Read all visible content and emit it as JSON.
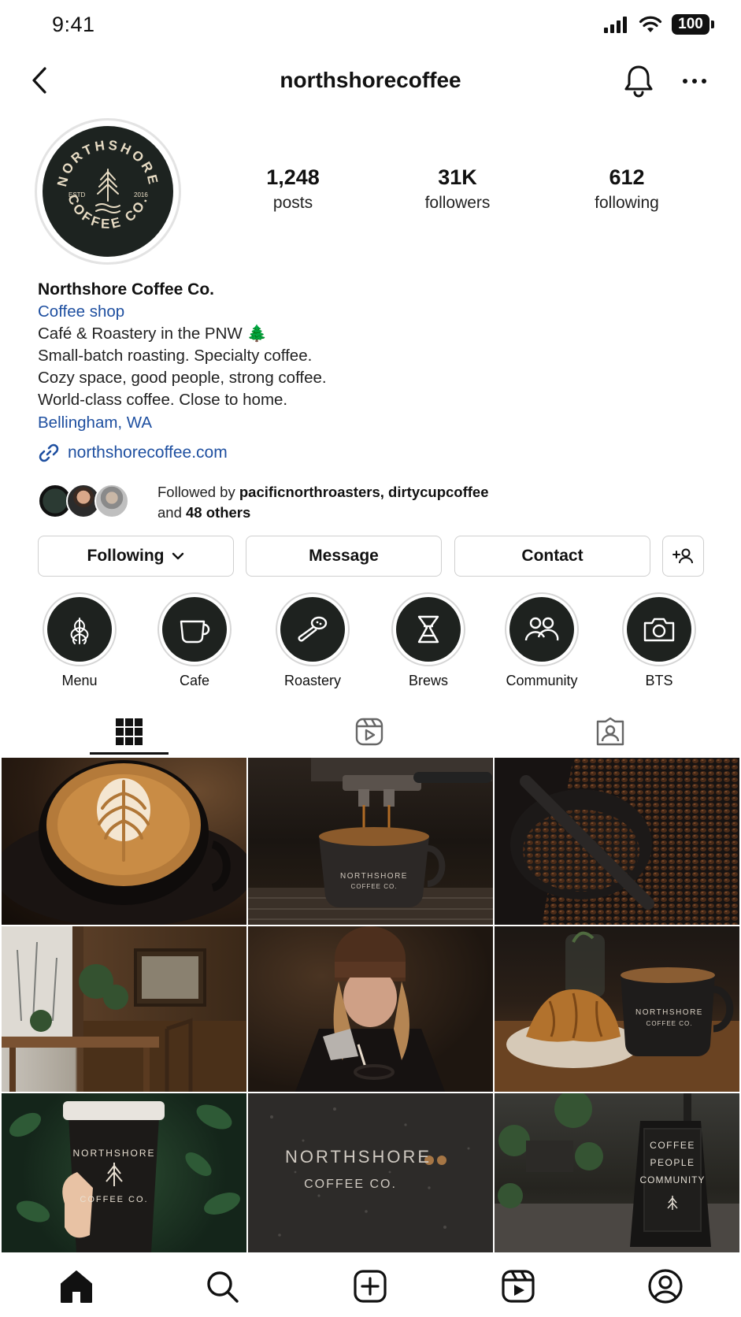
{
  "status_bar": {
    "time": "9:41",
    "battery": "100"
  },
  "header": {
    "username": "northshorecoffee"
  },
  "profile": {
    "avatar_text": {
      "top": "NORTHSHORE",
      "bottom": "COFFEE CO.",
      "left": "ESTD",
      "right": "2016"
    },
    "stats": [
      {
        "value": "1,248",
        "label": "posts"
      },
      {
        "value": "31K",
        "label": "followers"
      },
      {
        "value": "612",
        "label": "following"
      }
    ],
    "name": "Northshore Coffee Co.",
    "category": "Coffee shop",
    "bio_lines": [
      "Café & Roastery in the PNW 🌲",
      "Small-batch roasting. Specialty coffee.",
      "Cozy space, good people, strong coffee.",
      "World-class coffee. Close to home."
    ],
    "location": "Bellingham, WA",
    "link": "northshorecoffee.com"
  },
  "followed_by": {
    "prefix": "Followed by",
    "users": "pacificnorthroasters, dirtycupcoffee",
    "and": "and",
    "others": "48 others"
  },
  "actions": {
    "following": "Following",
    "message": "Message",
    "contact": "Contact"
  },
  "highlights": [
    {
      "label": "Menu",
      "icon": "latte-art-icon"
    },
    {
      "label": "Cafe",
      "icon": "cup-icon"
    },
    {
      "label": "Roastery",
      "icon": "roaster-scoop-icon"
    },
    {
      "label": "Brews",
      "icon": "chemex-icon"
    },
    {
      "label": "Community",
      "icon": "people-icon"
    },
    {
      "label": "BTS",
      "icon": "camera-icon"
    }
  ],
  "tabs": [
    "grid-icon",
    "reels-icon",
    "tagged-icon"
  ],
  "posts": {
    "cup_logo": {
      "top": "NORTHSHORE",
      "bottom": "COFFEE CO."
    },
    "window_text": {
      "top": "NORTHSHORE",
      "bottom": "COFFEE CO."
    },
    "sign_lines": [
      "COFFEE",
      "PEOPLE",
      "COMMUNITY"
    ]
  },
  "bottom_nav": [
    "home-icon",
    "search-icon",
    "create-icon",
    "reels-icon",
    "profile-icon"
  ]
}
